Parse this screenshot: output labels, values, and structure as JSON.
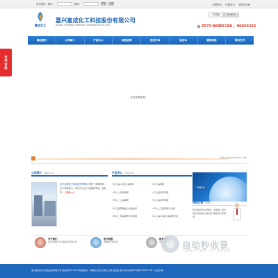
{
  "topbar": {
    "username_label": "会员登陆",
    "account_label": "账号：",
    "password_label": "密码：",
    "login_button": "登陆",
    "register_button": "注册",
    "links": [
      "· 设置首页",
      "· 收藏该页",
      "· 收藏该页面"
    ]
  },
  "header": {
    "logo_text": "富成化工",
    "company_name": "嘉兴富成化工科技股份有限公司",
    "company_name_en": "JIAXING FUCHENG CHEMICAL TECHNOLOGY CO.,LTD.",
    "languages": [
      "中文版",
      "English"
    ],
    "phone": "0573-86806188 ，86856222"
  },
  "nav": {
    "items": [
      "网站首页",
      "公司简介",
      "产品中心",
      "资质证明",
      "在线订单",
      "留言本",
      "销售网络",
      "联系方式"
    ]
  },
  "float_tab": {
    "chars": [
      "在",
      "线",
      "客",
      "服"
    ]
  },
  "main": {
    "empty_message": "无法加载信息。"
  },
  "banner": {
    "url": "http://www.fuchem.com"
  },
  "about": {
    "title": "公司简介",
    "subtitle": "About us",
    "text_highlight": "嘉兴富成化工科技股份有限公司",
    "text_body": "是一家集研发、生产和销售为一体的专业生产精细化学品、医药中...",
    "more": "[详细>>]"
  },
  "products": {
    "title": "产品中心",
    "subtitle": "Products",
    "items": [
      "N-乙基-N-氰乙基苯胺",
      "N-乙基苯胺",
      "N,N-二甲基苯胺",
      "N-乙基间甲苯胺",
      "N,N-二乙基苯胺",
      "N-乙基邻甲苯胺",
      "N-乙基苯胺盐分析报告表",
      "N,N-二乙基苯胺分析报",
      "N,N-二甲基苯胺分析报告",
      "N-乙基-N-氰乙基苯胺分析"
    ],
    "image_label": "产品中心"
  },
  "order": {
    "title": "在线订单",
    "subtitle": "order",
    "text": "我们提供专业化服务，请留言！我们将在对您提交资料进行审核后与您联系！"
  },
  "bottom": {
    "cards": [
      {
        "title": "关于我们",
        "sub": "嘉兴富成化工科技股份有限公司"
      },
      {
        "title": "电子地图",
        "sub": "查看我们的位置"
      },
      {
        "title": "联系我们",
        "sub": "欢迎来电垂询"
      }
    ]
  },
  "watermark": {
    "main": "自动秒收录",
    "sub": "一键提交→来访一次→自动收录"
  },
  "footer": {
    "text": "嘉兴富成化工科技股份有限公司 版权所有©2017 网络支持：中国化工网 全球化工网 生意宝 嘉兴市平湖 浙ICP备05048717号-1 后台管理"
  },
  "colors": {
    "brand_blue": "#1c66b8",
    "accent_red": "#d8392c",
    "float_tab_red": "#e52b2b"
  }
}
